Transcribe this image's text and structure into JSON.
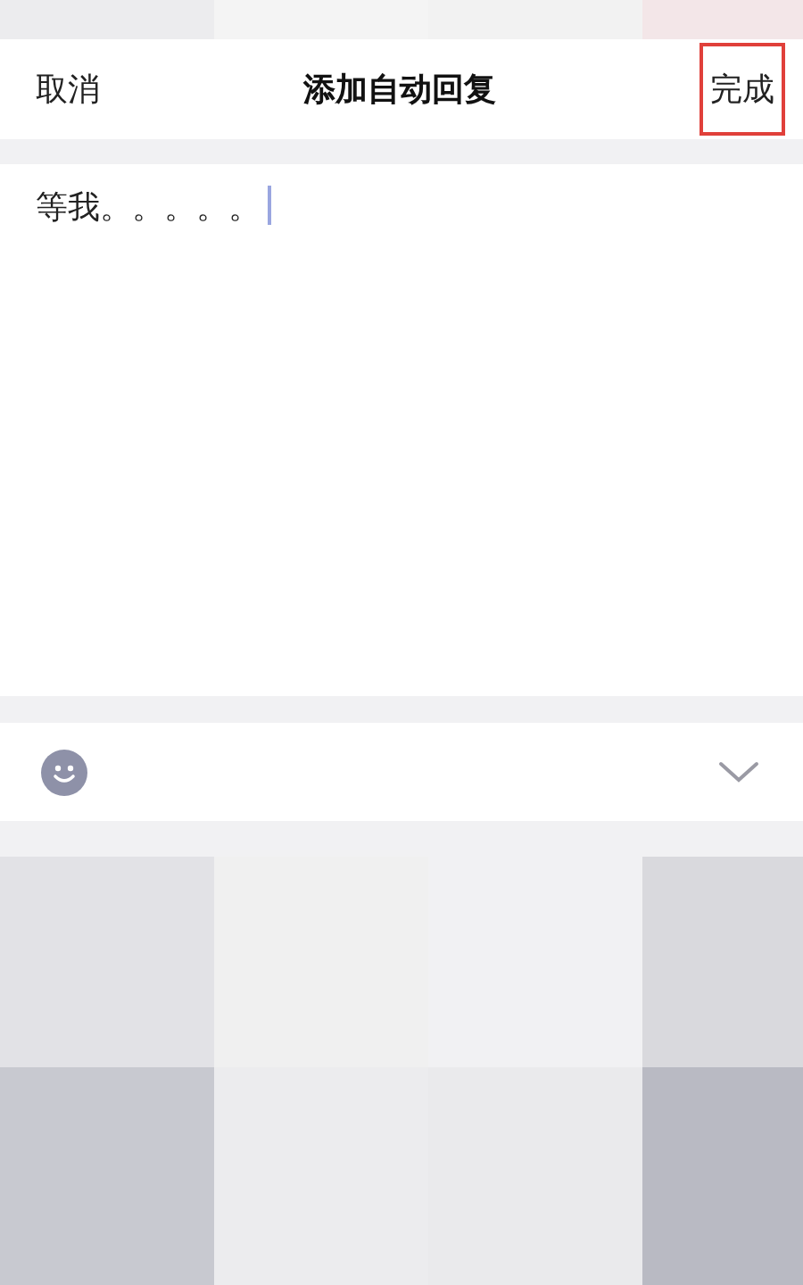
{
  "header": {
    "cancel": "取消",
    "title": "添加自动回复",
    "done": "完成",
    "done_highlighted": true
  },
  "editor": {
    "value": "等我。。。。。",
    "focused": true
  }
}
